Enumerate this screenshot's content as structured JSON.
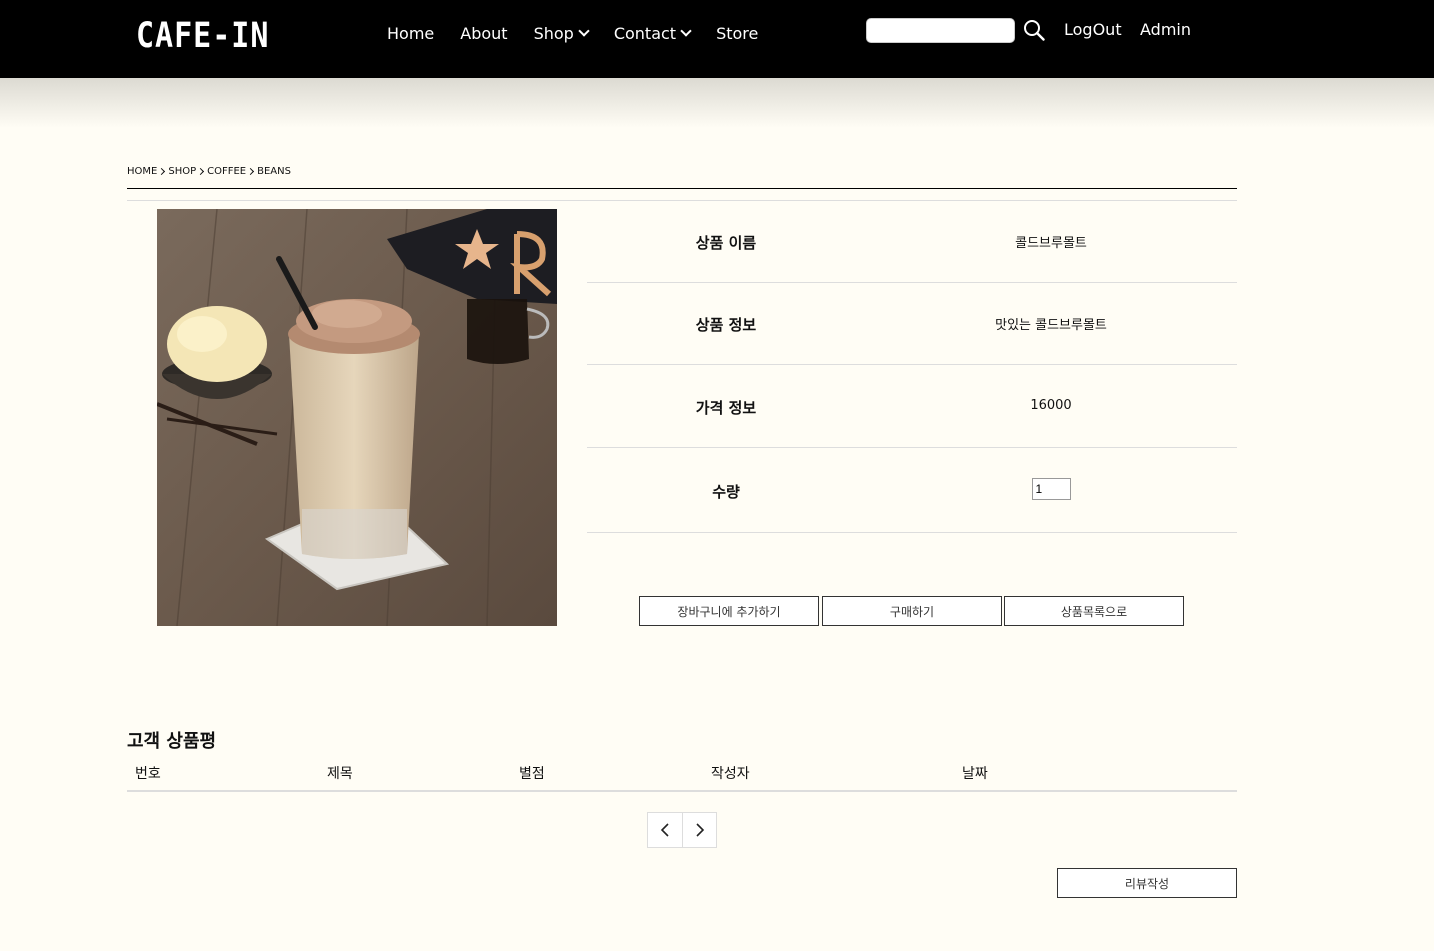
{
  "header": {
    "logo": "CAFE-IN",
    "nav": [
      {
        "label": "Home"
      },
      {
        "label": "About"
      },
      {
        "label": "Shop",
        "dropdown": true
      },
      {
        "label": "Contact",
        "dropdown": true
      },
      {
        "label": "Store"
      }
    ],
    "search": {
      "value": "",
      "placeholder": ""
    },
    "logout": "LogOut",
    "admin": "Admin"
  },
  "breadcrumb": [
    "HOME",
    "SHOP",
    "COFFEE",
    "BEANS"
  ],
  "product": {
    "rows": [
      {
        "label": "상품 이름",
        "value": "콜드브루몰트"
      },
      {
        "label": "상품 정보",
        "value": "맛있는 콜드브루몰트"
      },
      {
        "label": "가격 정보",
        "value": "16000"
      }
    ],
    "quantity_label": "수량",
    "quantity_value": "1"
  },
  "buttons": {
    "add_cart": "장바구니에 추가하기",
    "buy": "구매하기",
    "to_list": "상품목록으로"
  },
  "reviews": {
    "title": "고객 상품평",
    "columns": [
      "번호",
      "제목",
      "별점",
      "작성자",
      "날짜"
    ],
    "write_button": "리뷰작성"
  },
  "colors": {
    "header_bg": "#000000",
    "page_bg": "#fffdf5"
  }
}
